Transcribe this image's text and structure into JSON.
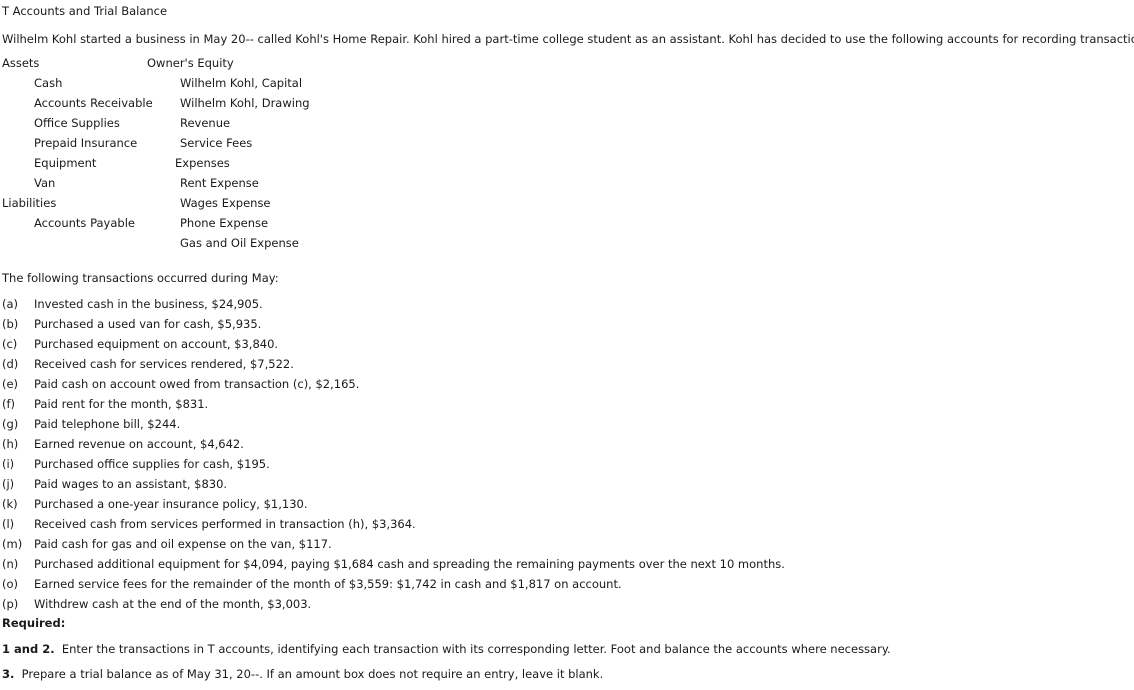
{
  "document": {
    "title": "T Accounts and Trial Balance",
    "intro": "Wilhelm Kohl started a business in May 20-- called Kohl's Home Repair. Kohl hired a part-time college student as an assistant. Kohl has decided to use the following accounts for recording transactions:"
  },
  "accounts": {
    "rows": [
      {
        "left": "Assets",
        "left_level": 0,
        "right": "Owner's Equity",
        "right_level": 0
      },
      {
        "left": "Cash",
        "left_level": 1,
        "right": "Wilhelm Kohl, Capital",
        "right_level": 1
      },
      {
        "left": "Accounts Receivable",
        "left_level": 1,
        "right": "Wilhelm Kohl, Drawing",
        "right_level": 1
      },
      {
        "left": "Office Supplies",
        "left_level": 1,
        "right": "Revenue",
        "right_level": 1
      },
      {
        "left": "Prepaid Insurance",
        "left_level": 1,
        "right": "Service Fees",
        "right_level": 1
      },
      {
        "left": "Equipment",
        "left_level": 1,
        "right": "Expenses",
        "right_level": 2
      },
      {
        "left": "Van",
        "left_level": 1,
        "right": "Rent Expense",
        "right_level": 1
      },
      {
        "left": "Liabilities",
        "left_level": 0,
        "right": "Wages Expense",
        "right_level": 1
      },
      {
        "left": "Accounts Payable",
        "left_level": 1,
        "right": "Phone Expense",
        "right_level": 1
      },
      {
        "left": "",
        "left_level": 1,
        "right": "Gas and Oil Expense",
        "right_level": 1
      }
    ]
  },
  "transactions": {
    "intro": "The following transactions occurred during May:",
    "items": [
      {
        "label": "(a)",
        "text": "Invested cash in the business, $24,905."
      },
      {
        "label": "(b)",
        "text": "Purchased a used van for cash, $5,935."
      },
      {
        "label": "(c)",
        "text": "Purchased equipment on account, $3,840."
      },
      {
        "label": "(d)",
        "text": "Received cash for services rendered, $7,522."
      },
      {
        "label": "(e)",
        "text": "Paid cash on account owed from transaction (c), $2,165."
      },
      {
        "label": "(f)",
        "text": "Paid rent for the month, $831."
      },
      {
        "label": "(g)",
        "text": "Paid telephone bill, $244."
      },
      {
        "label": "(h)",
        "text": "Earned revenue on account, $4,642."
      },
      {
        "label": "(i)",
        "text": "Purchased office supplies for cash, $195."
      },
      {
        "label": "(j)",
        "text": "Paid wages to an assistant, $830."
      },
      {
        "label": "(k)",
        "text": "Purchased a one-year insurance policy, $1,130."
      },
      {
        "label": "(l)",
        "text": "Received cash from services performed in transaction (h), $3,364."
      },
      {
        "label": "(m)",
        "text": "Paid cash for gas and oil expense on the van, $117."
      },
      {
        "label": "(n)",
        "text": "Purchased additional equipment for $4,094, paying $1,684 cash and spreading the remaining payments over the next 10 months."
      },
      {
        "label": "(o)",
        "text": "Earned service fees for the remainder of the month of $3,559: $1,742 in cash and $1,817 on account."
      },
      {
        "label": "(p)",
        "text": "Withdrew cash at the end of the month, $3,003."
      }
    ]
  },
  "required": {
    "heading": "Required:",
    "item1_number": "1 and 2.",
    "item1_text": "Enter the transactions in T accounts, identifying each transaction with its corresponding letter. Foot and balance the accounts where necessary.",
    "item2_number": "3.",
    "item2_text": "Prepare a trial balance as of May 31, 20--. If an amount box does not require an entry, leave it blank."
  }
}
